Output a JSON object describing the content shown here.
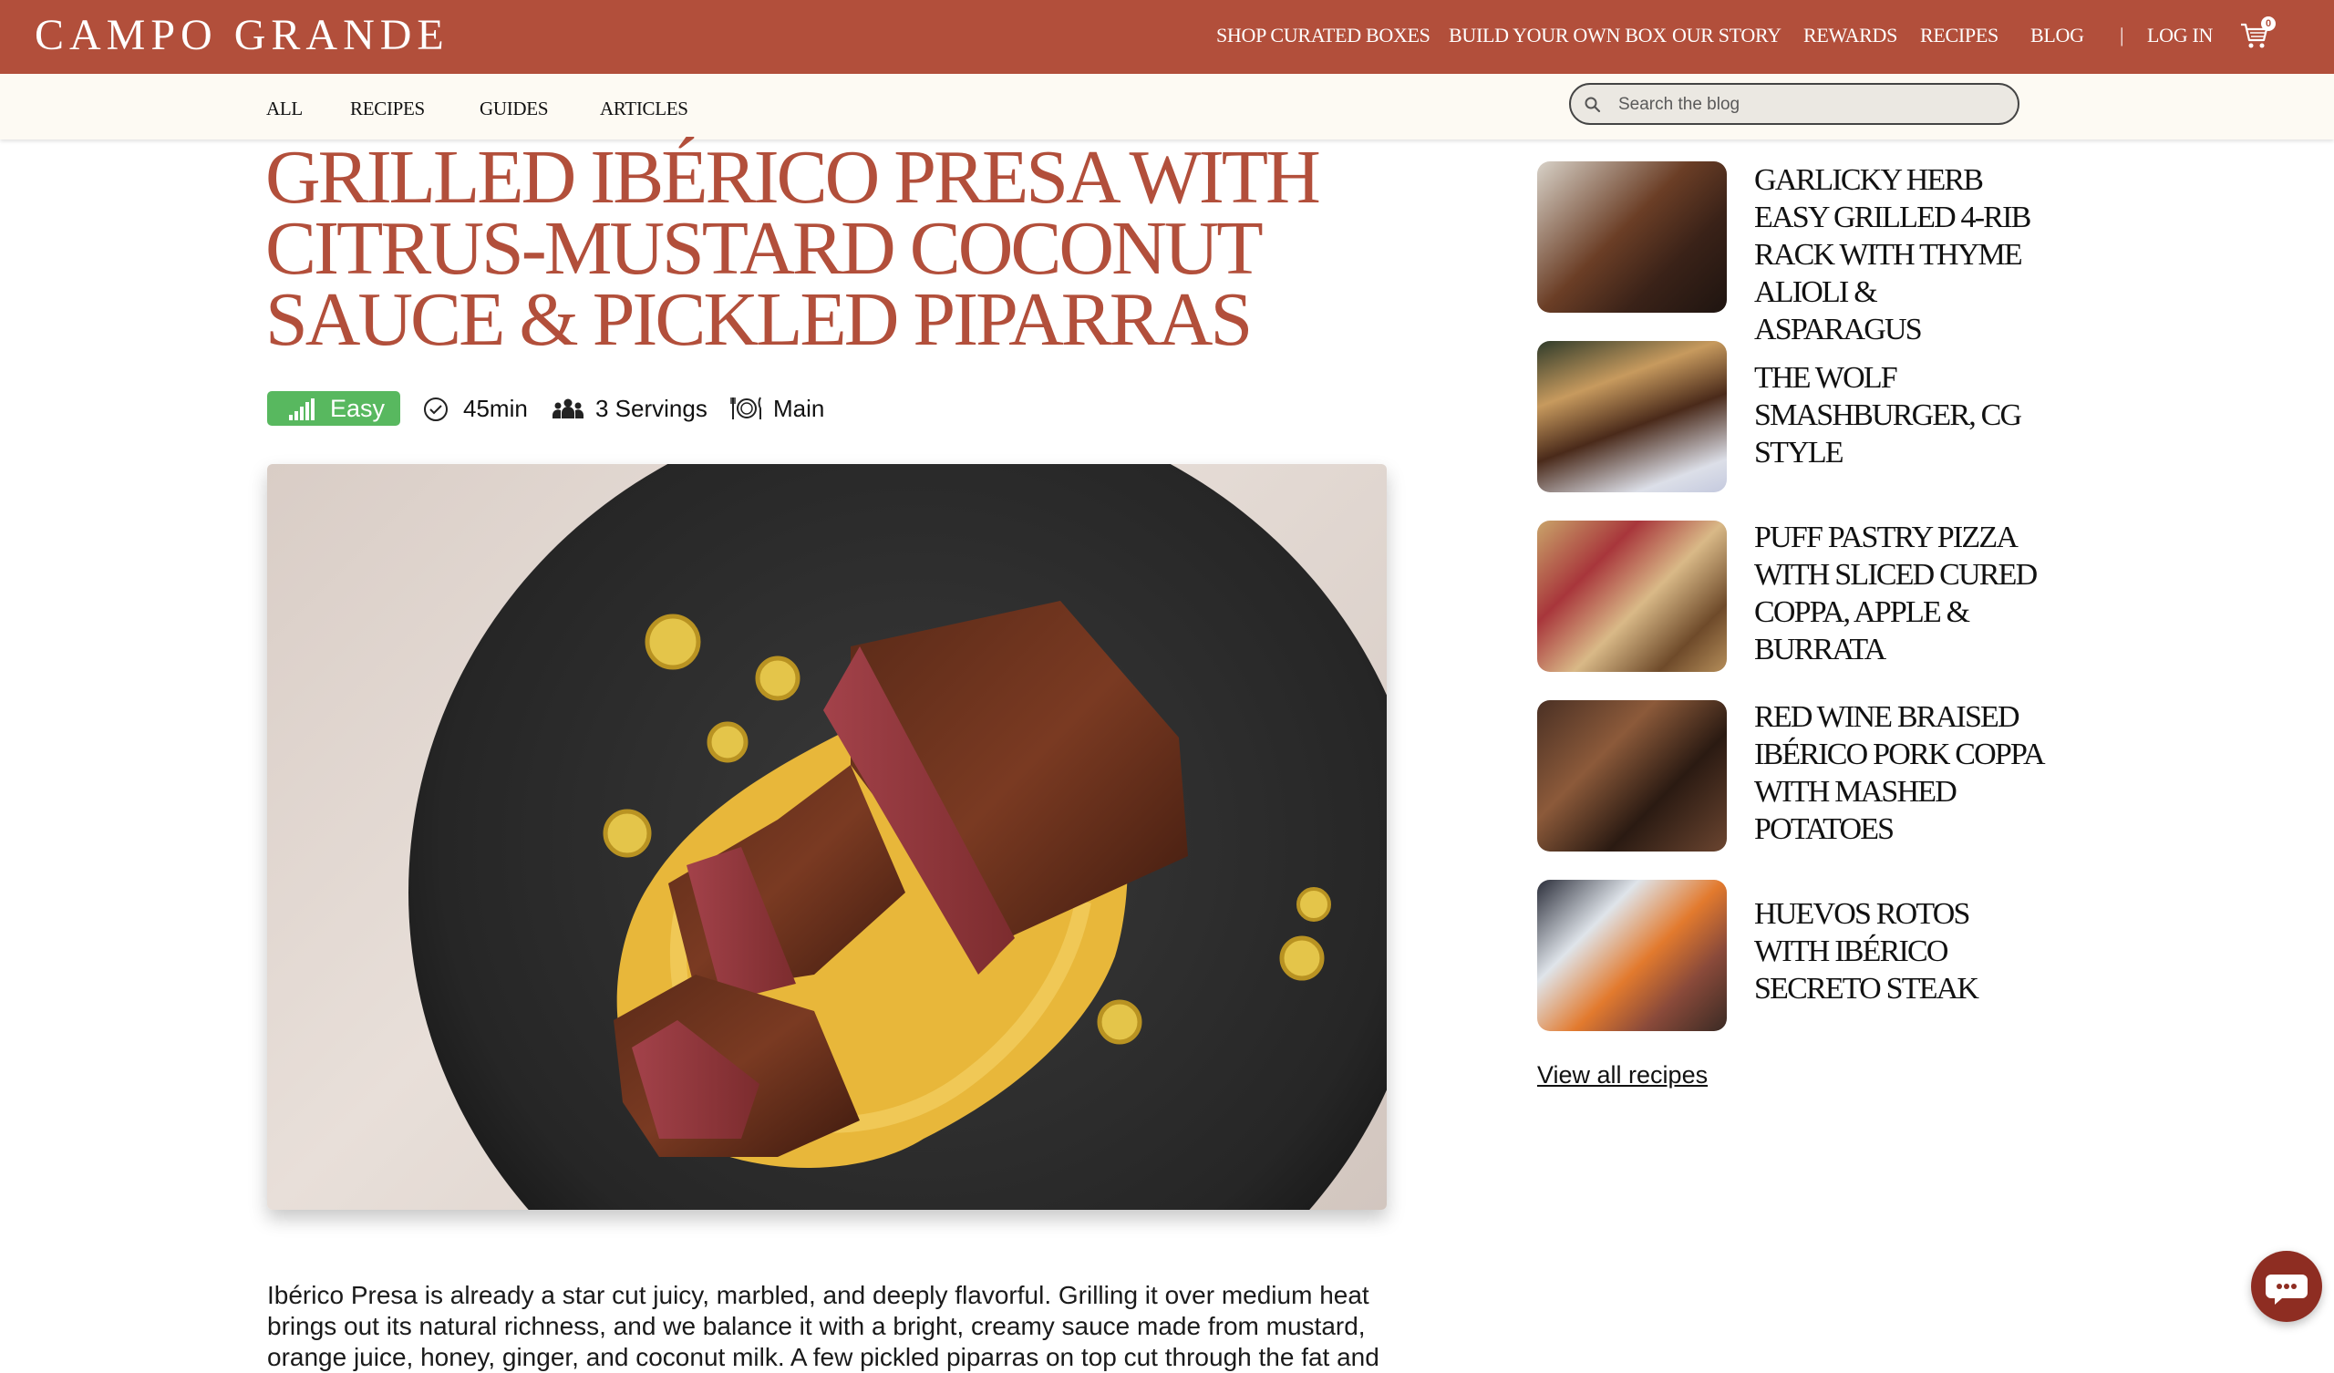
{
  "brand": {
    "logo": "CAMPO GRANDE"
  },
  "header": {
    "nav": [
      {
        "label": "SHOP CURATED BOXES"
      },
      {
        "label": "BUILD YOUR OWN BOX"
      },
      {
        "label": "OUR STORY"
      },
      {
        "label": "REWARDS"
      },
      {
        "label": "RECIPES"
      },
      {
        "label": "BLOG"
      }
    ],
    "separator": "|",
    "login": "LOG IN",
    "cart_count": "0"
  },
  "subnav": {
    "items": [
      {
        "label": "ALL"
      },
      {
        "label": "RECIPES"
      },
      {
        "label": "GUIDES"
      },
      {
        "label": "ARTICLES"
      }
    ],
    "search": {
      "placeholder": "Search the blog",
      "value": ""
    }
  },
  "article": {
    "title": "GRILLED IBÉRICO PRESA WITH CITRUS-MUSTARD COCONUT SAUCE & PICKLED PIPARRAS",
    "meta": {
      "difficulty": "Easy",
      "time": "45min",
      "servings": "3 Servings",
      "course": "Main"
    },
    "hero_image": "grilled-iberico-presa-plate",
    "intro": "Ibérico Presa is already a star cut  juicy, marbled, and deeply flavorful. Grilling it over medium heat brings out its natural richness, and we balance it with a bright, creamy sauce made from mustard, orange juice, honey, ginger, and coconut milk. A few pickled piparras on top cut through the fat and"
  },
  "sidebar": {
    "recipes": [
      {
        "title": "GARLICKY HERB EASY GRILLED 4-RIB RACK WITH THYME ALIOLI & ASPARAGUS",
        "image": "rack-of-ribs-photo"
      },
      {
        "title": "THE WOLF SMASHBURGER, CG STYLE",
        "image": "smashburger-photo"
      },
      {
        "title": "PUFF PASTRY PIZZA WITH SLICED CURED COPPA, APPLE & BURRATA",
        "image": "puff-pastry-pizza-photo"
      },
      {
        "title": "RED WINE BRAISED IBÉRICO PORK COPPA WITH MASHED POTATOES",
        "image": "braised-coppa-photo"
      },
      {
        "title": "HUEVOS ROTOS WITH IBÉRICO SECRETO STEAK",
        "image": "huevos-rotos-photo"
      }
    ],
    "view_all": "View all recipes"
  },
  "colors": {
    "brand": "#b24f3b",
    "subnav_bg": "#fdfaf3",
    "easy_badge": "#58b85f",
    "chat_button": "#8e2d22"
  }
}
